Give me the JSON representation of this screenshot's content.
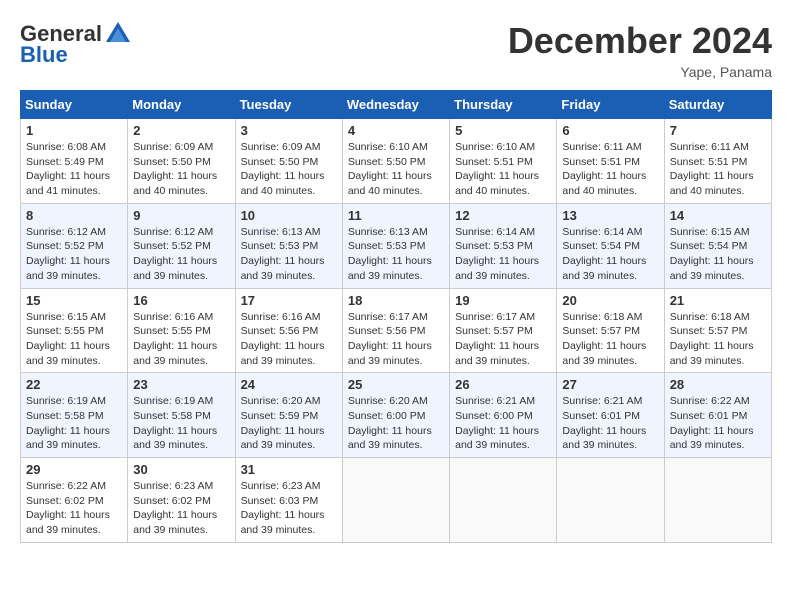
{
  "logo": {
    "general": "General",
    "blue": "Blue"
  },
  "title": {
    "month_year": "December 2024",
    "location": "Yape, Panama"
  },
  "weekdays": [
    "Sunday",
    "Monday",
    "Tuesday",
    "Wednesday",
    "Thursday",
    "Friday",
    "Saturday"
  ],
  "weeks": [
    [
      {
        "day": "1",
        "sunrise": "6:08 AM",
        "sunset": "5:49 PM",
        "daylight": "11 hours and 41 minutes."
      },
      {
        "day": "2",
        "sunrise": "6:09 AM",
        "sunset": "5:50 PM",
        "daylight": "11 hours and 40 minutes."
      },
      {
        "day": "3",
        "sunrise": "6:09 AM",
        "sunset": "5:50 PM",
        "daylight": "11 hours and 40 minutes."
      },
      {
        "day": "4",
        "sunrise": "6:10 AM",
        "sunset": "5:50 PM",
        "daylight": "11 hours and 40 minutes."
      },
      {
        "day": "5",
        "sunrise": "6:10 AM",
        "sunset": "5:51 PM",
        "daylight": "11 hours and 40 minutes."
      },
      {
        "day": "6",
        "sunrise": "6:11 AM",
        "sunset": "5:51 PM",
        "daylight": "11 hours and 40 minutes."
      },
      {
        "day": "7",
        "sunrise": "6:11 AM",
        "sunset": "5:51 PM",
        "daylight": "11 hours and 40 minutes."
      }
    ],
    [
      {
        "day": "8",
        "sunrise": "6:12 AM",
        "sunset": "5:52 PM",
        "daylight": "11 hours and 39 minutes."
      },
      {
        "day": "9",
        "sunrise": "6:12 AM",
        "sunset": "5:52 PM",
        "daylight": "11 hours and 39 minutes."
      },
      {
        "day": "10",
        "sunrise": "6:13 AM",
        "sunset": "5:53 PM",
        "daylight": "11 hours and 39 minutes."
      },
      {
        "day": "11",
        "sunrise": "6:13 AM",
        "sunset": "5:53 PM",
        "daylight": "11 hours and 39 minutes."
      },
      {
        "day": "12",
        "sunrise": "6:14 AM",
        "sunset": "5:53 PM",
        "daylight": "11 hours and 39 minutes."
      },
      {
        "day": "13",
        "sunrise": "6:14 AM",
        "sunset": "5:54 PM",
        "daylight": "11 hours and 39 minutes."
      },
      {
        "day": "14",
        "sunrise": "6:15 AM",
        "sunset": "5:54 PM",
        "daylight": "11 hours and 39 minutes."
      }
    ],
    [
      {
        "day": "15",
        "sunrise": "6:15 AM",
        "sunset": "5:55 PM",
        "daylight": "11 hours and 39 minutes."
      },
      {
        "day": "16",
        "sunrise": "6:16 AM",
        "sunset": "5:55 PM",
        "daylight": "11 hours and 39 minutes."
      },
      {
        "day": "17",
        "sunrise": "6:16 AM",
        "sunset": "5:56 PM",
        "daylight": "11 hours and 39 minutes."
      },
      {
        "day": "18",
        "sunrise": "6:17 AM",
        "sunset": "5:56 PM",
        "daylight": "11 hours and 39 minutes."
      },
      {
        "day": "19",
        "sunrise": "6:17 AM",
        "sunset": "5:57 PM",
        "daylight": "11 hours and 39 minutes."
      },
      {
        "day": "20",
        "sunrise": "6:18 AM",
        "sunset": "5:57 PM",
        "daylight": "11 hours and 39 minutes."
      },
      {
        "day": "21",
        "sunrise": "6:18 AM",
        "sunset": "5:57 PM",
        "daylight": "11 hours and 39 minutes."
      }
    ],
    [
      {
        "day": "22",
        "sunrise": "6:19 AM",
        "sunset": "5:58 PM",
        "daylight": "11 hours and 39 minutes."
      },
      {
        "day": "23",
        "sunrise": "6:19 AM",
        "sunset": "5:58 PM",
        "daylight": "11 hours and 39 minutes."
      },
      {
        "day": "24",
        "sunrise": "6:20 AM",
        "sunset": "5:59 PM",
        "daylight": "11 hours and 39 minutes."
      },
      {
        "day": "25",
        "sunrise": "6:20 AM",
        "sunset": "6:00 PM",
        "daylight": "11 hours and 39 minutes."
      },
      {
        "day": "26",
        "sunrise": "6:21 AM",
        "sunset": "6:00 PM",
        "daylight": "11 hours and 39 minutes."
      },
      {
        "day": "27",
        "sunrise": "6:21 AM",
        "sunset": "6:01 PM",
        "daylight": "11 hours and 39 minutes."
      },
      {
        "day": "28",
        "sunrise": "6:22 AM",
        "sunset": "6:01 PM",
        "daylight": "11 hours and 39 minutes."
      }
    ],
    [
      {
        "day": "29",
        "sunrise": "6:22 AM",
        "sunset": "6:02 PM",
        "daylight": "11 hours and 39 minutes."
      },
      {
        "day": "30",
        "sunrise": "6:23 AM",
        "sunset": "6:02 PM",
        "daylight": "11 hours and 39 minutes."
      },
      {
        "day": "31",
        "sunrise": "6:23 AM",
        "sunset": "6:03 PM",
        "daylight": "11 hours and 39 minutes."
      },
      null,
      null,
      null,
      null
    ]
  ]
}
